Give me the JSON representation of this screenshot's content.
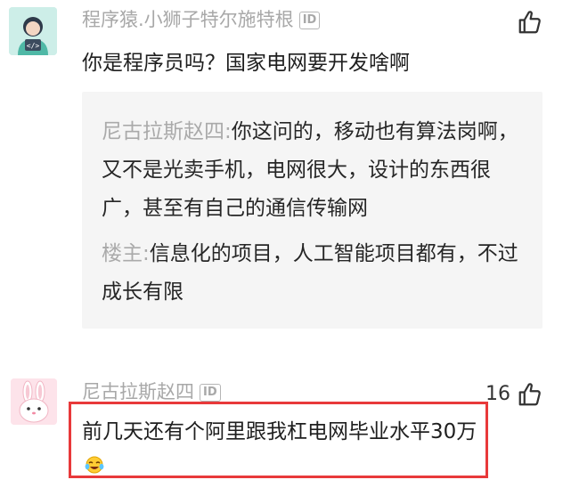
{
  "comment1": {
    "avatar_icon": "coder-avatar-icon",
    "username": "程序猿.小狮子特尔施特根",
    "id_badge": "ID",
    "text": "你是程序员吗？国家电网要开发啥啊",
    "like_icon": "thumbs-up-icon",
    "replies": [
      {
        "author": "尼古拉斯赵四:",
        "text": "你这问的，移动也有算法岗啊，又不是光卖手机，电网很大，设计的东西很广，甚至有自己的通信传输网"
      },
      {
        "author": "楼主:",
        "text": "信息化的项目，人工智能项目都有，不过成长有限"
      }
    ]
  },
  "comment2": {
    "avatar_icon": "bunny-avatar-icon",
    "username": "尼古拉斯赵四",
    "id_badge": "ID",
    "text": "前几天还有个阿里跟我杠电网毕业水平30万",
    "emoji_icon": "crying-laughing-emoji-icon",
    "like_count": "16",
    "like_icon": "thumbs-up-icon"
  },
  "colors": {
    "highlight_border": "#e8393a",
    "username": "#a8a8a8",
    "reply_background": "#f5f5f5"
  }
}
